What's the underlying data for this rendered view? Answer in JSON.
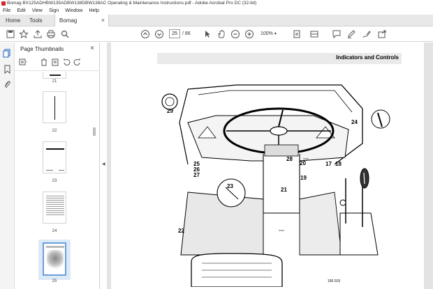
{
  "window": {
    "title": "Bomag BX125ADHBW135ADBW138DBW138AC Operating & Maintenance Instructions.pdf - Adobe Acrobat Pro DC (32-bit)"
  },
  "menu": {
    "items": [
      "File",
      "Edit",
      "View",
      "Sign",
      "Window",
      "Help"
    ]
  },
  "tabs": {
    "home": "Home",
    "tools": "Tools",
    "document": "Bomag BX125ADH..."
  },
  "toolbar": {
    "page_current": "25",
    "page_total": "/ 86",
    "zoom": "100%"
  },
  "panel": {
    "title": "Page Thumbnails",
    "thumbnails": [
      {
        "label": "21"
      },
      {
        "label": "22"
      },
      {
        "label": "23"
      },
      {
        "label": "24"
      },
      {
        "label": "25",
        "selected": true
      }
    ]
  },
  "document": {
    "header": "Indicators and Controls",
    "callouts": [
      "29",
      "24",
      "28",
      "25",
      "26",
      "27",
      "20",
      "17",
      "18",
      "19",
      "23",
      "21",
      "22"
    ],
    "figure_code": "150 019"
  },
  "colors": {
    "accent": "#d7232c",
    "selection": "#6a9fd8",
    "toolbar_bg": "#ffffff",
    "viewer_bg": "#e3e3e3"
  }
}
